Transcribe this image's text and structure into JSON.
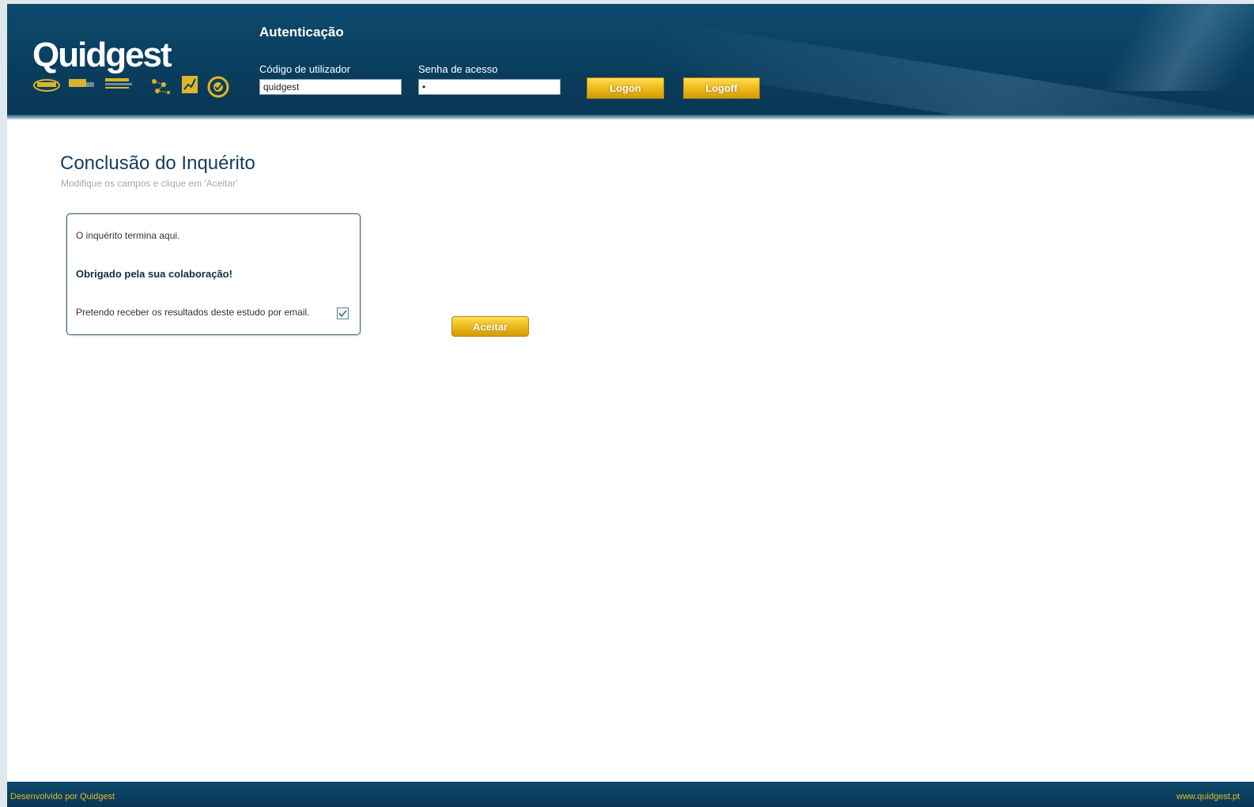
{
  "header": {
    "logo": "Quidgest",
    "product_icons": [
      "genio-icon",
      "card-icon",
      "banner-icon",
      "network-icon",
      "chart-icon",
      "check-badge-icon"
    ],
    "auth_title": "Autenticação",
    "username_label": "Código de utilizador",
    "username_value": "quidgest",
    "password_label": "Senha de acesso",
    "password_value": "•",
    "logon_label": "Logon",
    "logoff_label": "Logoff"
  },
  "page": {
    "title": "Conclusão do Inquérito",
    "subtitle": "Modifique os campos e clique em 'Aceitar'"
  },
  "panel": {
    "line1": "O inquérito termina aqui.",
    "line2": "Obrigado pela sua colaboração!",
    "line3": "Pretendo receber os resultados deste estudo por email.",
    "email_checked": true
  },
  "accept_label": "Aceitar",
  "footer": {
    "left": "Desenvolvido por Quidgest",
    "right": "www.quidgest.pt"
  },
  "colors": {
    "header_bg": "#0a3d5d",
    "accent_gold": "#f0bd20",
    "title_color": "#0e3e5e"
  }
}
